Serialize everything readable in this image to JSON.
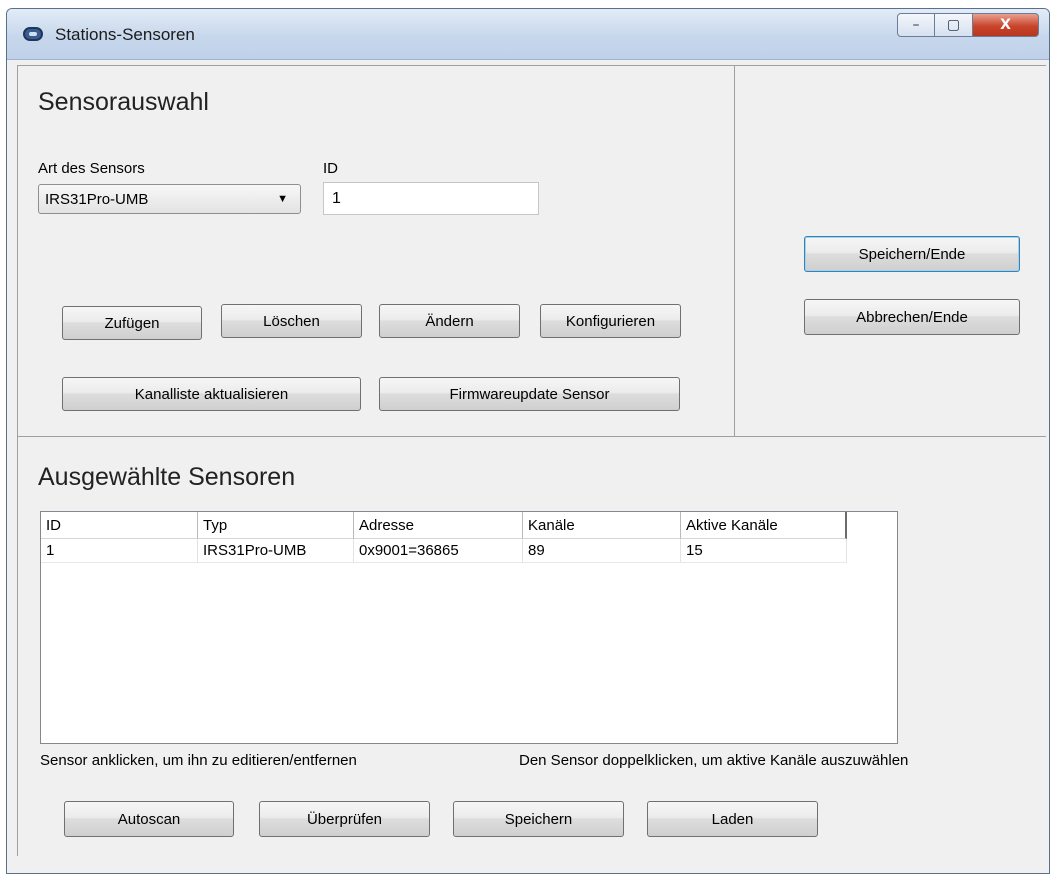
{
  "window": {
    "title": "Stations-Sensoren",
    "caption_buttons": {
      "minimize": "–",
      "maximize": "▢",
      "close": "X"
    }
  },
  "selection": {
    "heading": "Sensorauswahl",
    "sensor_type_label": "Art des Sensors",
    "sensor_type_value": "IRS31Pro-UMB",
    "id_label": "ID",
    "id_value": "1",
    "buttons": {
      "add": "Zufügen",
      "delete": "Löschen",
      "change": "Ändern",
      "configure": "Konfigurieren",
      "refresh_channels": "Kanalliste aktualisieren",
      "firmware_update": "Firmwareupdate Sensor"
    }
  },
  "actions": {
    "save_end": "Speichern/Ende",
    "cancel_end": "Abbrechen/Ende"
  },
  "selected": {
    "heading": "Ausgewählte Sensoren",
    "columns": [
      "ID",
      "Typ",
      "Adresse",
      "Kanäle",
      "Aktive Kanäle"
    ],
    "rows": [
      [
        "1",
        "IRS31Pro-UMB",
        "0x9001=36865",
        "89",
        "15"
      ]
    ],
    "hint_left": "Sensor anklicken, um ihn zu editieren/entfernen",
    "hint_right": "Den Sensor doppelklicken, um aktive Kanäle auszuwählen",
    "buttons": {
      "autoscan": "Autoscan",
      "check": "Überprüfen",
      "save": "Speichern",
      "load": "Laden"
    }
  }
}
